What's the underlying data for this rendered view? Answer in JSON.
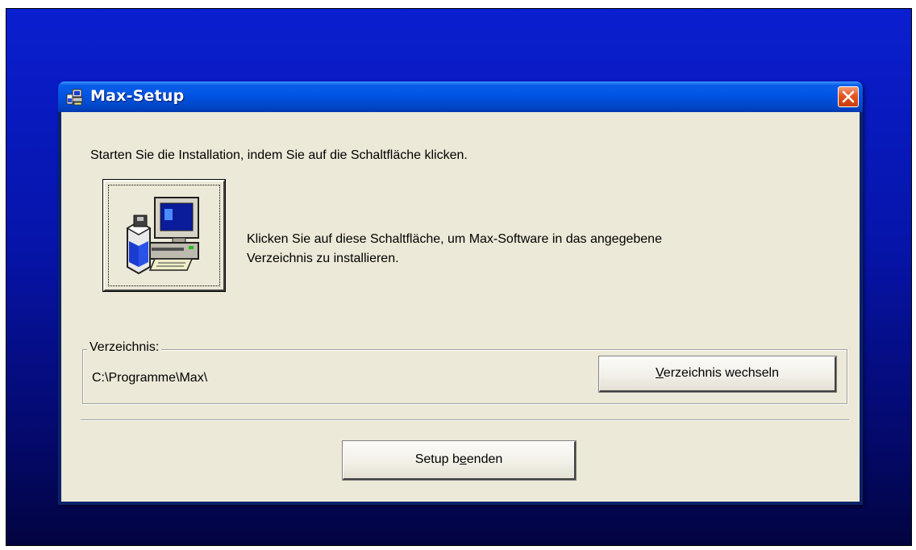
{
  "window": {
    "title": "Max-Setup"
  },
  "intro_text": "Starten Sie die Installation, indem Sie auf die Schaltfläche klicken.",
  "install": {
    "description_line1": "Klicken Sie auf diese Schaltfläche, um Max-Software in das angegebene",
    "description_line2": "Verzeichnis zu installieren.",
    "icon": "setup-computer-icon"
  },
  "directory": {
    "group_label": "Verzeichnis:",
    "path": "C:\\Programme\\Max\\",
    "change_button": {
      "mnemonic": "V",
      "rest": "erzeichnis wechseln"
    }
  },
  "exit_button": {
    "pre": "Setup b",
    "mnemonic": "e",
    "post": "enden"
  },
  "colors": {
    "desktop": "#0614a8",
    "titlebar": "#0054e3",
    "client": "#ece9d8",
    "close": "#e5541d"
  }
}
